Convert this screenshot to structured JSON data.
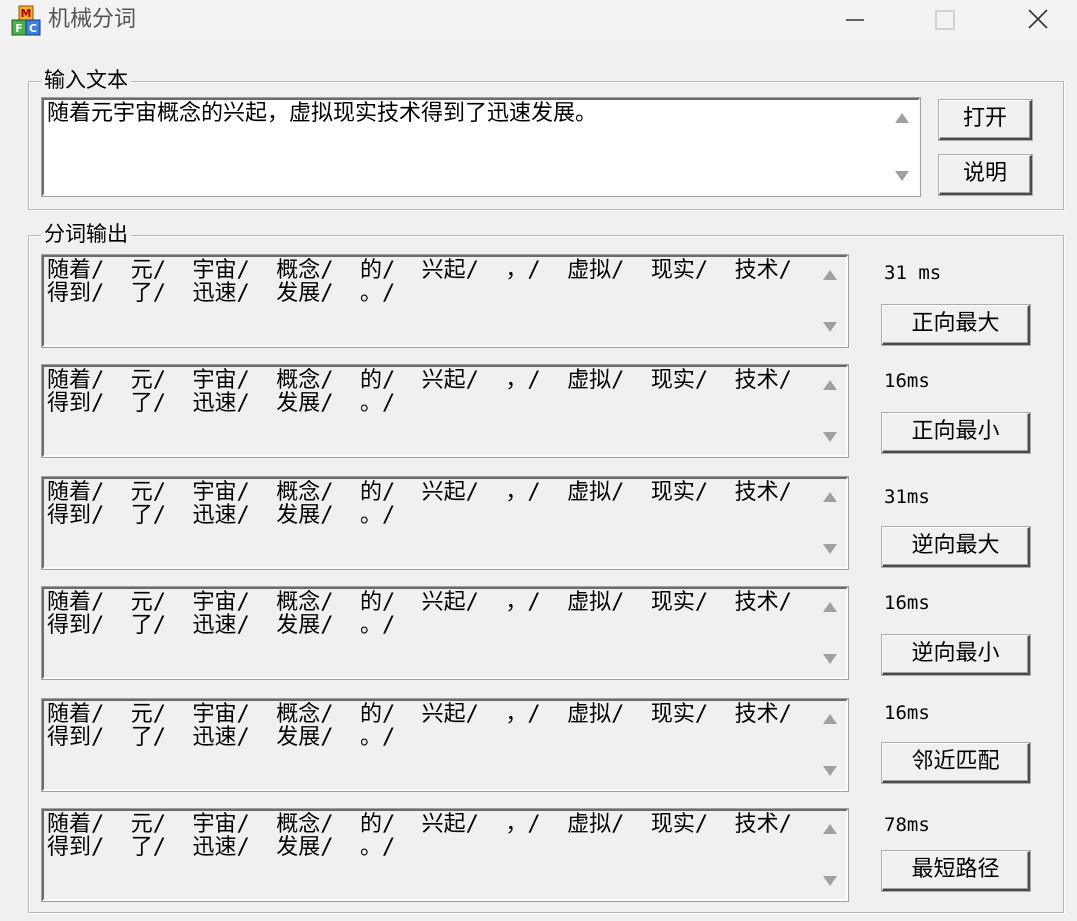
{
  "window": {
    "title": "机械分词",
    "icon": "mfc-app-icon",
    "icon_letters": [
      "M",
      "F",
      "C"
    ]
  },
  "input_group": {
    "legend": "输入文本",
    "text": "随着元宇宙概念的兴起，虚拟现实技术得到了迅速发展。",
    "open_button": "打开",
    "help_button": "说明"
  },
  "output_group": {
    "legend": "分词输出",
    "rows": [
      {
        "text": "随着/  元/  宇宙/  概念/  的/  兴起/  ，/  虚拟/  现实/  技术/  得到/  了/  迅速/  发展/  。/",
        "time": "31 ms",
        "button": "正向最大"
      },
      {
        "text": "随着/  元/  宇宙/  概念/  的/  兴起/  ，/  虚拟/  现实/  技术/  得到/  了/  迅速/  发展/  。/",
        "time": "16ms",
        "button": "正向最小"
      },
      {
        "text": "随着/  元/  宇宙/  概念/  的/  兴起/  ，/  虚拟/  现实/  技术/  得到/  了/  迅速/  发展/  。/",
        "time": "31ms",
        "button": "逆向最大"
      },
      {
        "text": "随着/  元/  宇宙/  概念/  的/  兴起/  ，/  虚拟/  现实/  技术/  得到/  了/  迅速/  发展/  。/",
        "time": "16ms",
        "button": "逆向最小"
      },
      {
        "text": "随着/  元/  宇宙/  概念/  的/  兴起/  ，/  虚拟/  现实/  技术/  得到/  了/  迅速/  发展/  。/",
        "time": "16ms",
        "button": "邻近匹配"
      },
      {
        "text": "随着/  元/  宇宙/  概念/  的/  兴起/  ，/  虚拟/  现实/  技术/  得到/  了/  迅速/  发展/  。/",
        "time": "78ms",
        "button": "最短路径"
      }
    ]
  }
}
